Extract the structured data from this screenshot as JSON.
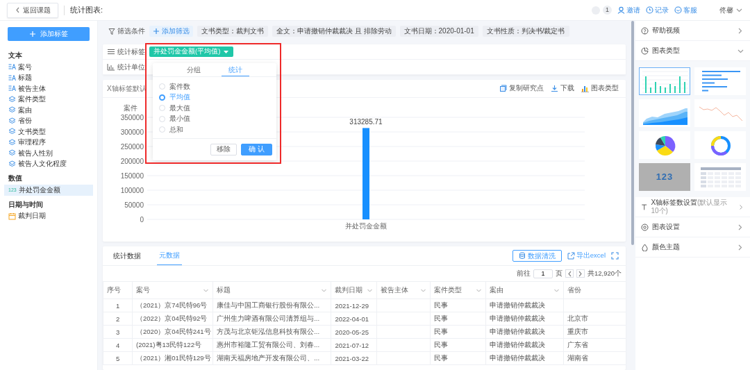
{
  "top_bar": {
    "back_button": "返回课题",
    "title": "统计图表:",
    "notification_count": "1",
    "links": [
      {
        "kind": "invite",
        "label": "邀请"
      },
      {
        "kind": "history",
        "label": "记录"
      },
      {
        "kind": "support",
        "label": "客服"
      }
    ],
    "user": "佟馨"
  },
  "sidebar": {
    "add_button": "添加标签",
    "groups": [
      {
        "title": "文本",
        "items": [
          {
            "kind": "text",
            "label": "案号",
            "selected": false
          },
          {
            "kind": "text",
            "label": "标题",
            "selected": false
          },
          {
            "kind": "text",
            "label": "被告主体",
            "selected": false
          },
          {
            "kind": "category",
            "label": "案件类型",
            "selected": false
          },
          {
            "kind": "category",
            "label": "案由",
            "selected": false
          },
          {
            "kind": "category",
            "label": "省份",
            "selected": false
          },
          {
            "kind": "category",
            "label": "文书类型",
            "selected": false
          },
          {
            "kind": "category",
            "label": "审理程序",
            "selected": false
          },
          {
            "kind": "category",
            "label": "被告人性别",
            "selected": false
          },
          {
            "kind": "category",
            "label": "被告人文化程度",
            "selected": false
          }
        ]
      },
      {
        "title": "数值",
        "items": [
          {
            "kind": "number",
            "badge": "123",
            "label": "并处罚金金额",
            "selected": true
          }
        ]
      },
      {
        "title": "日期与时间",
        "items": [
          {
            "kind": "date",
            "label": "裁判日期",
            "selected": false
          }
        ]
      }
    ]
  },
  "filter_bar": {
    "label": "筛选条件",
    "add_button": "添加筛选",
    "chips": [
      "文书类型：裁判文书",
      "全文：申请撤销仲裁裁决 且 排除劳动",
      "文书日期：2020-01-01",
      "文书性质：判决书/裁定书"
    ]
  },
  "settings": {
    "stat_tag_label": "统计标签",
    "stat_tag": "并处罚金金额(平均值)",
    "stat_unit_label": "统计单位"
  },
  "popover": {
    "tabs": [
      {
        "label": "分组",
        "selected": false
      },
      {
        "label": "统计",
        "selected": true
      }
    ],
    "options": [
      {
        "label": "案件数",
        "selected": false
      },
      {
        "label": "平均值",
        "selected": true
      },
      {
        "label": "最大值",
        "selected": false
      },
      {
        "label": "最小值",
        "selected": false
      },
      {
        "label": "总和",
        "selected": false
      }
    ],
    "buttons": [
      {
        "kind": "secondary",
        "label": "移除"
      },
      {
        "kind": "primary",
        "label": "确 认"
      }
    ]
  },
  "chart_card": {
    "x_label_hint": "X轴标签默认",
    "actions": [
      {
        "kind": "copy",
        "label": "复制研究点"
      },
      {
        "kind": "download",
        "label": "下载"
      },
      {
        "kind": "chart",
        "label": "图表类型"
      }
    ],
    "chart_data": {
      "type": "bar",
      "ylabel": "案件",
      "categories": [
        "并处罚金金额"
      ],
      "series": [
        {
          "color": "#1890ff",
          "values": [
            313285.71
          ]
        }
      ],
      "grid": true,
      "ylim": [
        0,
        350000
      ],
      "yticks": [
        0,
        50000,
        100000,
        150000,
        200000,
        250000,
        300000,
        350000
      ],
      "data_labels": true
    }
  },
  "table_card": {
    "tabs": [
      {
        "label": "统计数据",
        "selected": false
      },
      {
        "label": "元数据",
        "selected": true
      }
    ],
    "clean_button": "数据清洗",
    "export_link": "导出excel",
    "pagination": {
      "goto_label": "前往",
      "page": "1",
      "page_label": "页",
      "total": "共12,920个"
    },
    "columns": [
      {
        "label": "序号",
        "filter": false
      },
      {
        "label": "案号",
        "filter": true
      },
      {
        "label": "标题",
        "filter": true
      },
      {
        "label": "裁判日期",
        "filter": true
      },
      {
        "label": "被告主体",
        "filter": true
      },
      {
        "label": "案件类型",
        "filter": true
      },
      {
        "label": "案由",
        "filter": true
      },
      {
        "label": "省份",
        "filter": false
      }
    ],
    "rows": [
      [
        "1",
        "（2021）京74民特96号",
        "康佳与中国工商银行股份有限公...",
        "2021-12-29",
        null,
        "民事",
        "申请撤销仲裁裁决",
        null
      ],
      [
        "2",
        "（2022）京04民特92号",
        "广州生力啤酒有限公司清算组与...",
        "2022-04-01",
        null,
        "民事",
        "申请撤销仲裁裁决",
        "北京市"
      ],
      [
        "3",
        "（2020）京04民特241号",
        "方茂与北京钜泓信息科技有限公...",
        "2020-05-25",
        null,
        "民事",
        "申请撤销仲裁裁决",
        "重庆市"
      ],
      [
        "4",
        "(2021)粤13民特122号",
        "惠州市裕隆工贸有限公司、刘春...",
        "2021-07-12",
        null,
        "民事",
        "申请撤销仲裁裁决",
        "广东省"
      ],
      [
        "5",
        "（2021）湘01民特129号",
        "湖南天福房地产开发有限公司、...",
        "2021-03-22",
        null,
        "民事",
        "申请撤销仲裁裁决",
        "湖南省"
      ]
    ]
  },
  "right_panel": {
    "sections_top": [
      {
        "kind": "help",
        "label": "帮助视频",
        "expanded": false
      },
      {
        "kind": "chart_type",
        "label": "图表类型",
        "expanded": true
      }
    ],
    "chart_types": [
      {
        "kind": "bar",
        "selected": true
      },
      {
        "kind": "hbar",
        "selected": false
      },
      {
        "kind": "area",
        "selected": false
      },
      {
        "kind": "line",
        "selected": false
      },
      {
        "kind": "pie",
        "selected": false
      },
      {
        "kind": "donut",
        "selected": false
      },
      {
        "kind": "number",
        "text": "123",
        "selected": false
      },
      {
        "kind": "table",
        "selected": false
      }
    ],
    "sections_bottom": [
      {
        "kind": "axis",
        "label": "X轴标签数设置",
        "hint": "(默认显示10个)",
        "expanded": false
      },
      {
        "kind": "settings",
        "label": "图表设置",
        "expanded": false
      },
      {
        "kind": "theme",
        "label": "颜色主题",
        "expanded": false
      }
    ]
  }
}
